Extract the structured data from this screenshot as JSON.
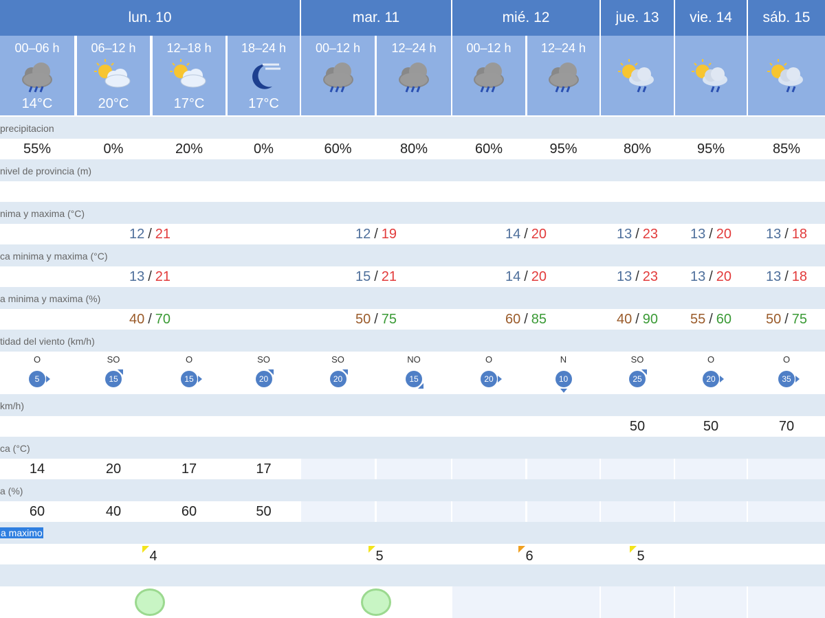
{
  "days": [
    {
      "label": "lun. 10"
    },
    {
      "label": "mar. 11"
    },
    {
      "label": "mié. 12"
    },
    {
      "label": "jue. 13"
    },
    {
      "label": "vie. 14"
    },
    {
      "label": "sáb. 15"
    }
  ],
  "slots": [
    {
      "label": "00–06 h",
      "temp": "14°C",
      "icon": "cloud-rain-icon"
    },
    {
      "label": "06–12 h",
      "temp": "20°C",
      "icon": "sun-cloud-icon"
    },
    {
      "label": "12–18 h",
      "temp": "17°C",
      "icon": "sun-cloud-icon"
    },
    {
      "label": "18–24 h",
      "temp": "17°C",
      "icon": "moon-fog-icon"
    },
    {
      "label": "00–12 h",
      "temp": "",
      "icon": "cloud-rain-icon"
    },
    {
      "label": "12–24 h",
      "temp": "",
      "icon": "cloud-rain-icon"
    },
    {
      "label": "00–12 h",
      "temp": "",
      "icon": "cloud-rain-icon"
    },
    {
      "label": "12–24 h",
      "temp": "",
      "icon": "cloud-rain-icon"
    },
    {
      "label": "",
      "temp": "",
      "icon": "sun-cloud-rain-icon"
    },
    {
      "label": "",
      "temp": "",
      "icon": "sun-cloud-rain-icon"
    },
    {
      "label": "",
      "temp": "",
      "icon": "sun-cloud-rain-icon"
    }
  ],
  "rows": {
    "precip_label": "precipitacion",
    "precip": [
      "55%",
      "0%",
      "20%",
      "0%",
      "60%",
      "80%",
      "60%",
      "95%",
      "80%",
      "95%",
      "85%"
    ],
    "snow_label": "nivel de provincia (m)",
    "temp_label": "nima y maxima (°C)",
    "temp": [
      {
        "min": "12",
        "max": "21"
      },
      {
        "min": "12",
        "max": "19"
      },
      {
        "min": "14",
        "max": "20"
      },
      {
        "min": "13",
        "max": "23"
      },
      {
        "min": "13",
        "max": "20"
      },
      {
        "min": "13",
        "max": "18"
      }
    ],
    "feels_label": "ca minima y maxima (°C)",
    "feels": [
      {
        "min": "13",
        "max": "21"
      },
      {
        "min": "15",
        "max": "21"
      },
      {
        "min": "14",
        "max": "20"
      },
      {
        "min": "13",
        "max": "23"
      },
      {
        "min": "13",
        "max": "20"
      },
      {
        "min": "13",
        "max": "18"
      }
    ],
    "hum_label": "a minima y maxima (%)",
    "humidity": [
      {
        "min": "40",
        "max": "70"
      },
      {
        "min": "50",
        "max": "75"
      },
      {
        "min": "60",
        "max": "85"
      },
      {
        "min": "40",
        "max": "90"
      },
      {
        "min": "55",
        "max": "60"
      },
      {
        "min": "50",
        "max": "75"
      }
    ],
    "wind_label": "tidad del viento (km/h)",
    "wind": [
      {
        "dir": "O",
        "speed": "5"
      },
      {
        "dir": "SO",
        "speed": "15"
      },
      {
        "dir": "O",
        "speed": "15"
      },
      {
        "dir": "SO",
        "speed": "20"
      },
      {
        "dir": "SO",
        "speed": "20"
      },
      {
        "dir": "NO",
        "speed": "15"
      },
      {
        "dir": "O",
        "speed": "20"
      },
      {
        "dir": "N",
        "speed": "10"
      },
      {
        "dir": "SO",
        "speed": "25"
      },
      {
        "dir": "O",
        "speed": "20"
      },
      {
        "dir": "O",
        "speed": "35"
      }
    ],
    "gust_label": "km/h)",
    "gust": [
      "50",
      "50",
      "70"
    ],
    "sens_label": "ca (°C)",
    "sens": [
      "14",
      "20",
      "17",
      "17"
    ],
    "rh_label": "a (%)",
    "rh": [
      "60",
      "40",
      "60",
      "50"
    ],
    "uv_label": "a maximo",
    "uv": [
      "4",
      "5",
      "6",
      "5"
    ]
  }
}
